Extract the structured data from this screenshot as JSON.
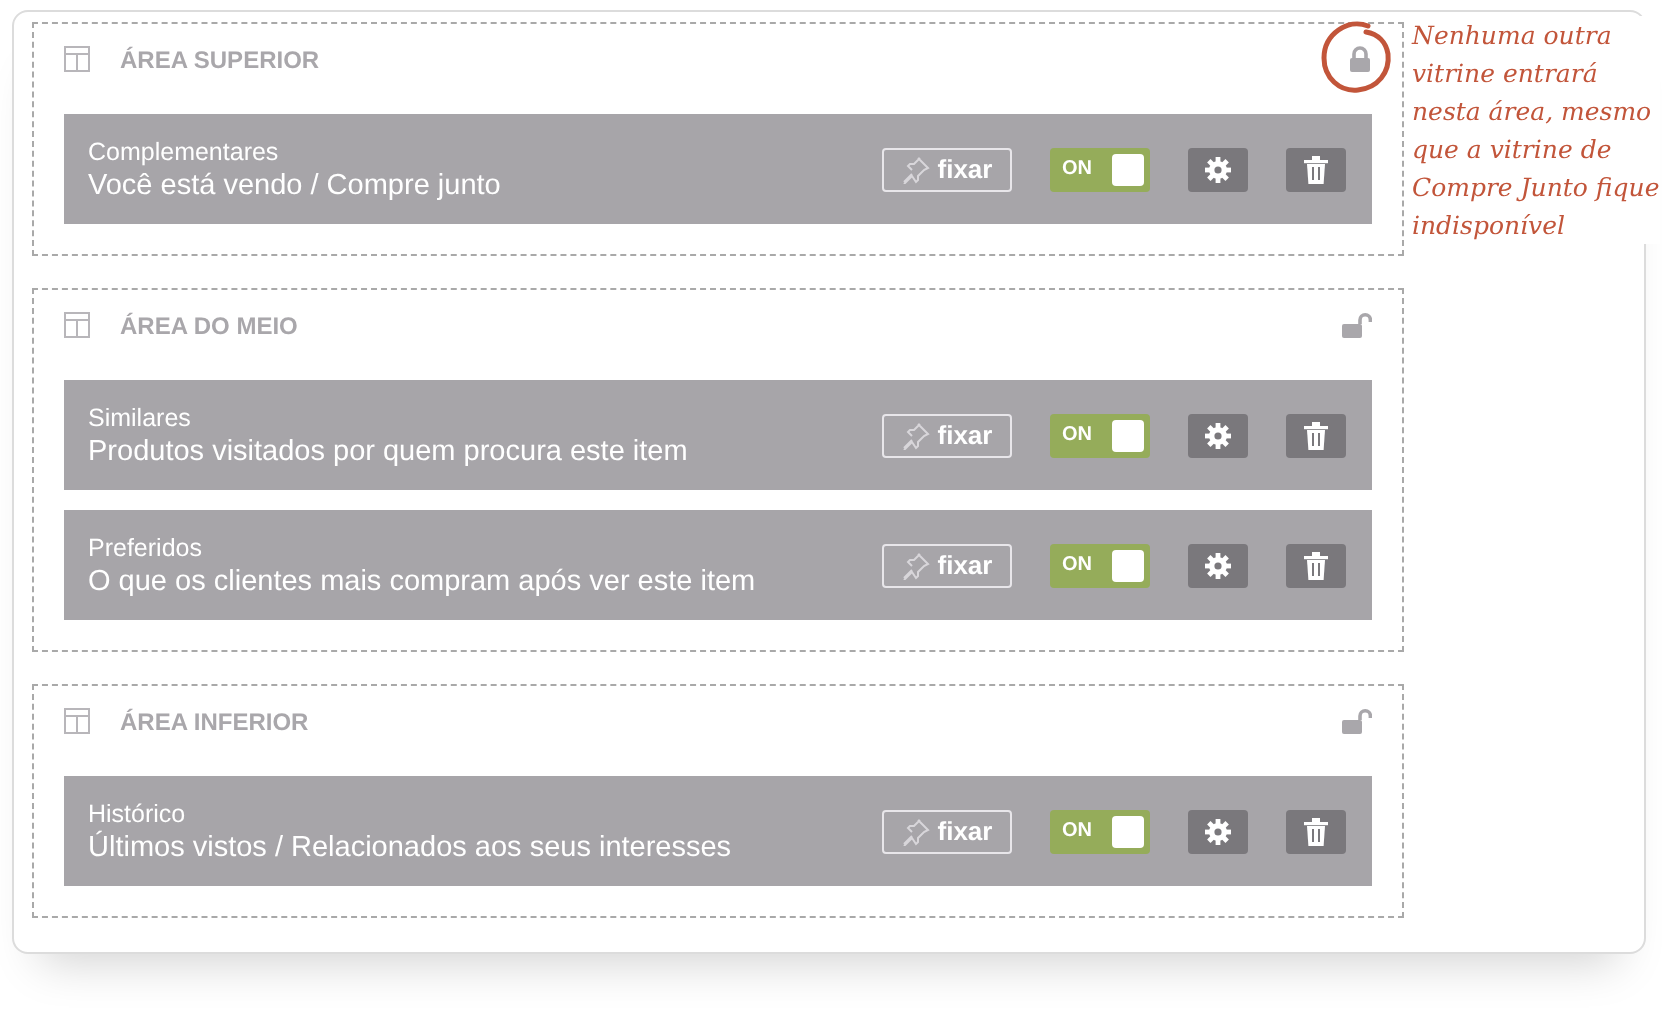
{
  "areas": [
    {
      "title": "ÁREA SUPERIOR",
      "locked": true,
      "rows": [
        {
          "category": "Complementares",
          "description": "Você está vendo / Compre junto",
          "pin_label": "fixar",
          "toggle_label": "ON",
          "on": true
        }
      ]
    },
    {
      "title": "ÁREA DO MEIO",
      "locked": false,
      "rows": [
        {
          "category": "Similares",
          "description": "Produtos visitados por quem procura este item",
          "pin_label": "fixar",
          "toggle_label": "ON",
          "on": true
        },
        {
          "category": "Preferidos",
          "description": "O que os clientes mais compram após ver este item",
          "pin_label": "fixar",
          "toggle_label": "ON",
          "on": true
        }
      ]
    },
    {
      "title": "ÁREA INFERIOR",
      "locked": false,
      "rows": [
        {
          "category": "Histórico",
          "description": "Últimos vistos / Relacionados aos seus interesses",
          "pin_label": "fixar",
          "toggle_label": "ON",
          "on": true
        }
      ]
    }
  ],
  "annotation": "Nenhuma outra vitrine entrará nesta área, mesmo que a vitrine de Compre Junto fique indisponível"
}
